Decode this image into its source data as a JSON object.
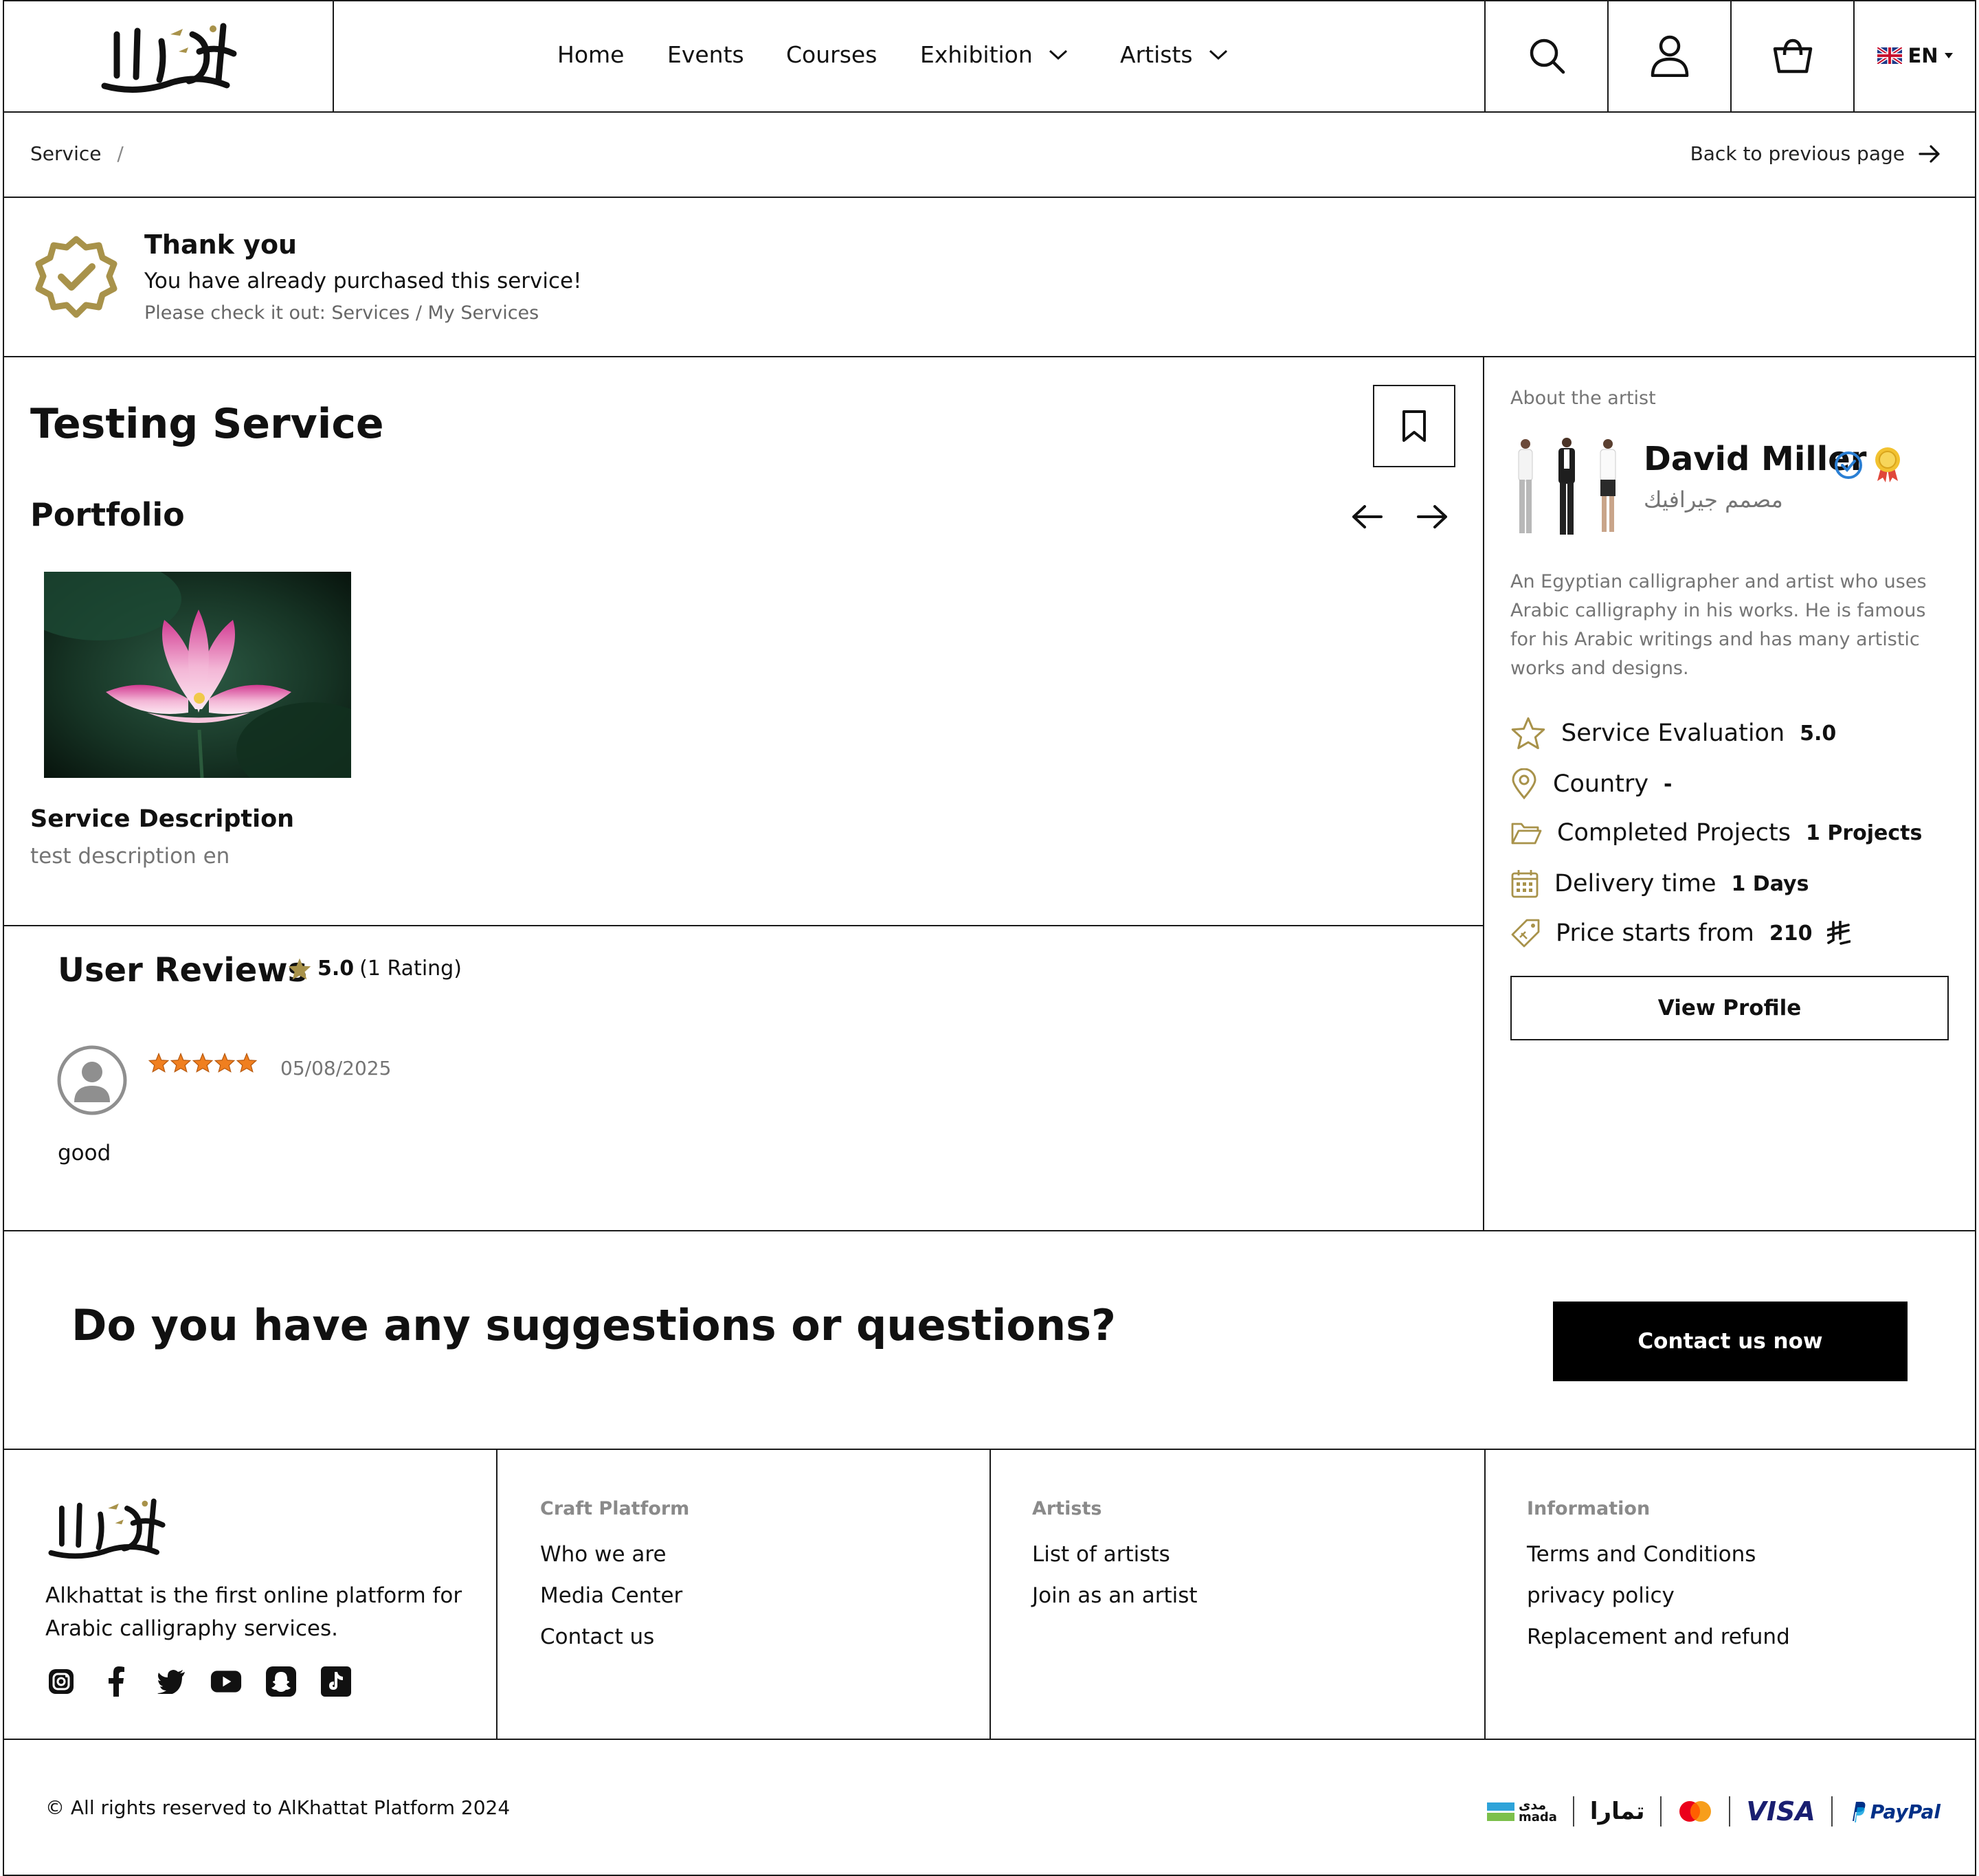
{
  "header": {
    "logo_alt": "الخطاط",
    "nav": [
      {
        "label": "Home"
      },
      {
        "label": "Events"
      },
      {
        "label": "Courses"
      },
      {
        "label": "Exhibition"
      },
      {
        "label": "Artists"
      }
    ],
    "language": "EN"
  },
  "breadcrumb": {
    "current": "Service",
    "separator": "/",
    "back_label": "Back to previous page"
  },
  "notice": {
    "title": "Thank you",
    "message": "You have already purchased this service!",
    "hint": "Please check it out: Services / My Services"
  },
  "service": {
    "title": "Testing Service",
    "portfolio_heading": "Portfolio",
    "description_heading": "Service Description",
    "description": "test description en"
  },
  "reviews": {
    "heading": "User Reviews",
    "average": "5.0",
    "count_text": "(1 Rating)",
    "items": [
      {
        "date": "05/08/2025",
        "text": "good",
        "stars": 5
      }
    ]
  },
  "artist": {
    "section_label": "About the artist",
    "name": "David Miller",
    "role": "مصمم جيرافيك",
    "bio": "An Egyptian calligrapher and artist who uses Arabic calligraphy in his works. He is famous for his Arabic writings and has many artistic works and designs.",
    "stats": [
      {
        "icon": "star-icon",
        "label": "Service Evaluation",
        "value": "5.0"
      },
      {
        "icon": "location-pin-icon",
        "label": "Country",
        "value": "-"
      },
      {
        "icon": "folder-icon",
        "label": "Completed Projects",
        "value": "1 Projects"
      },
      {
        "icon": "calendar-icon",
        "label": "Delivery time",
        "value": "1 Days"
      },
      {
        "icon": "price-tag-icon",
        "label": "Price starts from",
        "value": "210"
      }
    ],
    "view_profile_label": "View Profile"
  },
  "cta": {
    "question": "Do you have any suggestions or questions?",
    "button": "Contact us now"
  },
  "footer": {
    "tagline_line1": "Alkhattat is the first online platform for",
    "tagline_line2": "Arabic calligraphy services.",
    "columns": [
      {
        "heading": "Craft Platform",
        "links": [
          "Who we are",
          "Media Center",
          "Contact us"
        ]
      },
      {
        "heading": "Artists",
        "links": [
          "List of artists",
          "Join as an artist"
        ]
      },
      {
        "heading": "Information",
        "links": [
          "Terms and Conditions",
          "privacy policy",
          "Replacement and refund"
        ]
      }
    ],
    "copyright": "© All rights reserved to AlKhattat Platform 2024",
    "payments": {
      "mada_ar": "مدى",
      "mada": "mada",
      "tamara": "تمارا",
      "visa": "VISA",
      "paypal": "PayPal"
    }
  },
  "colors": {
    "gold": "#a8924a",
    "orange_star": "#f07f1f",
    "verified_blue": "#2a7fd4",
    "border": "#1a1a1a"
  }
}
